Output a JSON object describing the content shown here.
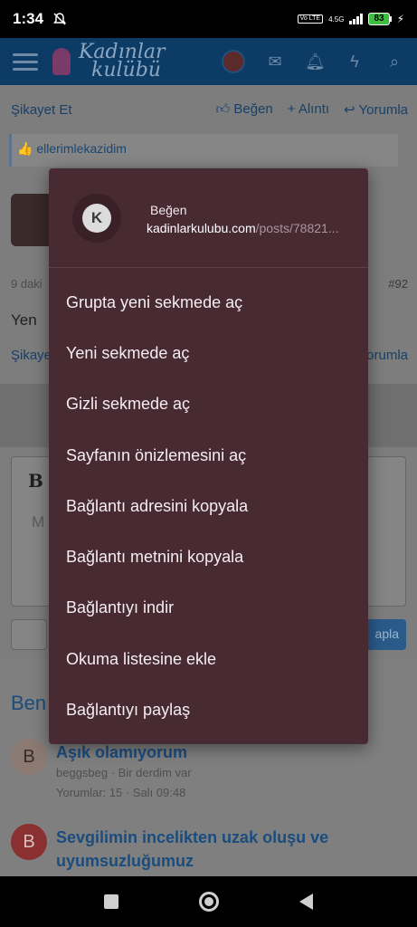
{
  "status_bar": {
    "time": "1:34",
    "lte_badge": "Vo LTE",
    "network": "4.5G",
    "battery": "83"
  },
  "header": {
    "logo_line1": "Kadınlar",
    "logo_line2": "kulübü"
  },
  "post_actions": {
    "report": "Şikayet Et",
    "like": "Beğen",
    "quote": "+ Alıntı",
    "reply": "Yorumla"
  },
  "reaction_line": "ellerimlekazidim",
  "post2": {
    "time_partial": "9 daki",
    "number": "#92",
    "text_partial": "Yen",
    "report_partial": "Şikaye",
    "reply_partial": "orumla"
  },
  "editor": {
    "bold_label": "B",
    "placeholder_partial": "M"
  },
  "reply_button_partial": "apla",
  "similar": {
    "title_partial": "Ben",
    "threads": [
      {
        "initial": "B",
        "title": "Aşık olamıyorum",
        "meta": "beggsbeg · Bir derdim var",
        "stats": "Yorumlar: 15 · Salı 09:48"
      },
      {
        "initial": "B",
        "title": "Sevgilimin incelikten uzak oluşu ve uyumsuzluğumuz"
      }
    ]
  },
  "context_menu": {
    "avatar_letter": "K",
    "title": "Beğen",
    "url_domain": "kadinlarkulubu.com",
    "url_path": "/posts/78821...",
    "items": [
      "Grupta yeni sekmede aç",
      "Yeni sekmede aç",
      "Gizli sekmede aç",
      "Sayfanın önizlemesini aç",
      "Bağlantı adresini kopyala",
      "Bağlantı metnini kopyala",
      "Bağlantıyı indir",
      "Okuma listesine ekle",
      "Bağlantıyı paylaş"
    ]
  },
  "colors": {
    "menu_bg": "#482a33",
    "header_bg": "#0c3c66",
    "overlay": "#7a7a7a"
  }
}
